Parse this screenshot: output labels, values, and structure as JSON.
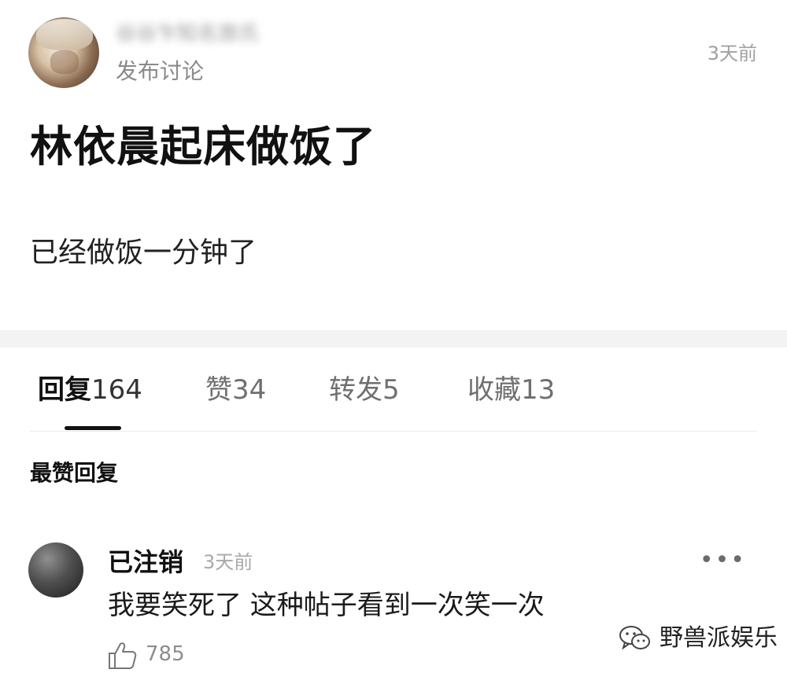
{
  "post": {
    "username": "谷谷乍知名旅氏",
    "type_label": "发布讨论",
    "time": "3天前",
    "title": "林依晨起床做饭了",
    "body": "已经做饭一分钟了"
  },
  "tabs": [
    {
      "label": "回复",
      "count": "164"
    },
    {
      "label": "赞",
      "count": "34"
    },
    {
      "label": "转发",
      "count": "5"
    },
    {
      "label": "收藏",
      "count": "13"
    }
  ],
  "section_title": "最赞回复",
  "reply": {
    "name": "已注销",
    "time": "3天前",
    "more": "•••",
    "text": "我要笑死了 这种帖子看到一次笑一次",
    "likes": "785"
  },
  "watermark": {
    "text": "野兽派娱乐",
    "icon": "wechat-icon"
  },
  "colors": {
    "text": "#111111",
    "muted": "#8a8a8a",
    "divider": "#f3f3f3",
    "indicator": "#111111"
  }
}
